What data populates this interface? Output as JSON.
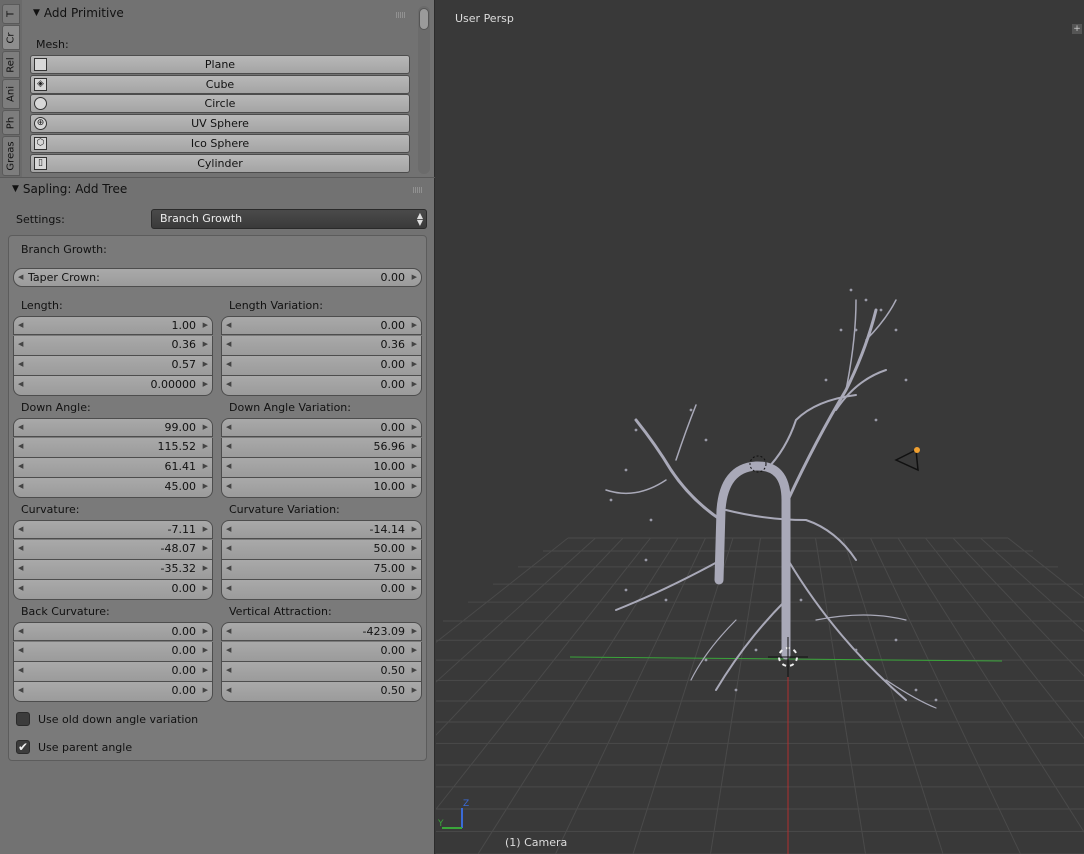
{
  "tabs": [
    "T",
    "Cr",
    "Rel",
    "Ani",
    "Ph",
    "Greas"
  ],
  "add_primitive": {
    "title": "Add Primitive",
    "mesh_label": "Mesh:",
    "items": [
      {
        "label": "Plane",
        "icon": "plane-icon"
      },
      {
        "label": "Cube",
        "icon": "cube-icon"
      },
      {
        "label": "Circle",
        "icon": "circle-icon"
      },
      {
        "label": "UV Sphere",
        "icon": "uv-sphere-icon"
      },
      {
        "label": "Ico Sphere",
        "icon": "ico-sphere-icon"
      },
      {
        "label": "Cylinder",
        "icon": "cylinder-icon"
      }
    ]
  },
  "sapling": {
    "title": "Sapling: Add Tree",
    "settings_label": "Settings:",
    "settings_value": "Branch Growth",
    "section_title": "Branch Growth:",
    "taper_crown": {
      "label": "Taper Crown:",
      "value": "0.00"
    },
    "groups": [
      {
        "left_title": "Length:",
        "left": [
          "1.00",
          "0.36",
          "0.57",
          "0.00000"
        ],
        "right_title": "Length Variation:",
        "right": [
          "0.00",
          "0.36",
          "0.00",
          "0.00"
        ]
      },
      {
        "left_title": "Down Angle:",
        "left": [
          "99.00",
          "115.52",
          "61.41",
          "45.00"
        ],
        "right_title": "Down Angle Variation:",
        "right": [
          "0.00",
          "56.96",
          "10.00",
          "10.00"
        ]
      },
      {
        "left_title": "Curvature:",
        "left": [
          "-7.11",
          "-48.07",
          "-35.32",
          "0.00"
        ],
        "right_title": "Curvature Variation:",
        "right": [
          "-14.14",
          "50.00",
          "75.00",
          "0.00"
        ]
      },
      {
        "left_title": "Back Curvature:",
        "left": [
          "0.00",
          "0.00",
          "0.00",
          "0.00"
        ],
        "right_title": "Vertical Attraction:",
        "right": [
          "-423.09",
          "0.00",
          "0.50",
          "0.50"
        ]
      }
    ],
    "checkboxes": [
      {
        "label": "Use old down angle variation",
        "checked": false
      },
      {
        "label": "Use parent angle",
        "checked": true
      }
    ]
  },
  "viewport": {
    "title": "User Persp",
    "object_label": "(1) Camera",
    "axis_x_color": "#3aa63a",
    "axis_y_color": "#b03030",
    "tree_color": "#a9a9b8"
  }
}
